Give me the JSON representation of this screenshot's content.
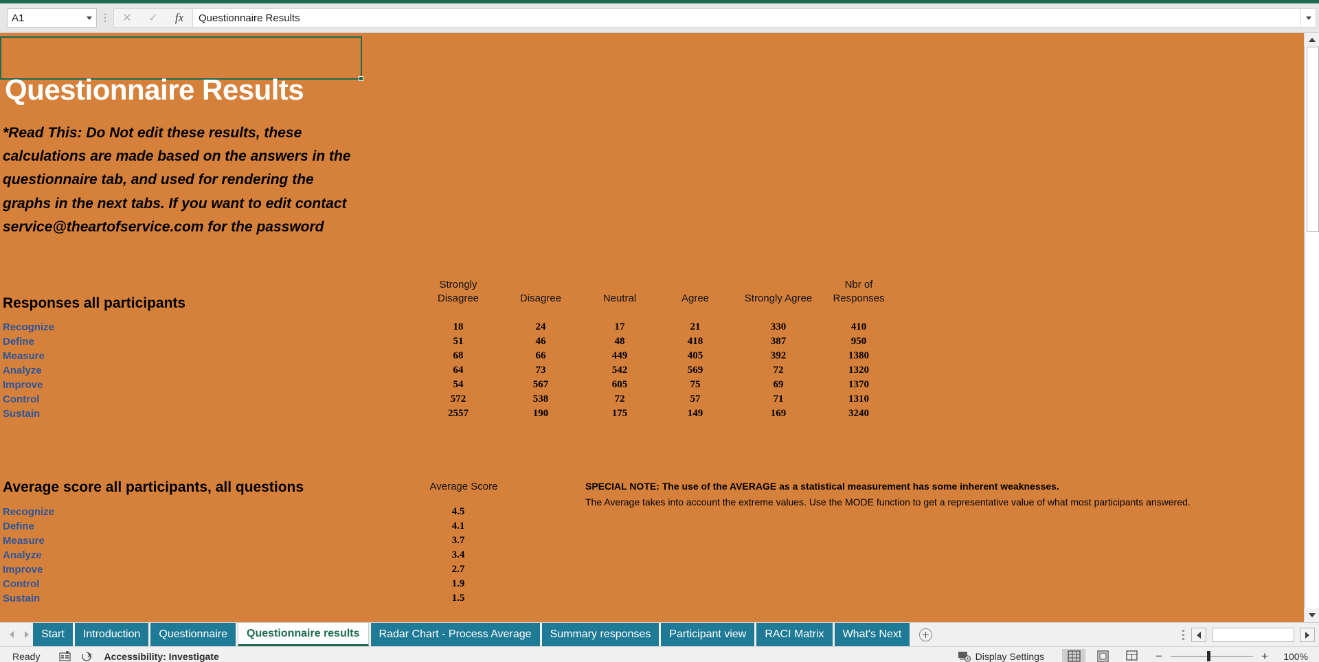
{
  "formula_bar": {
    "name_box": "A1",
    "cancel_icon": "close-icon",
    "confirm_icon": "check-icon",
    "function_icon": "fx-icon",
    "value": "Questionnaire Results"
  },
  "sheet": {
    "title": "Questionnaire Results",
    "warning": "*Read This: Do Not edit these results, these calculations are made based on the answers in the questionnaire tab, and used for rendering the graphs in the next tabs. If you want to edit contact service@theartofservice.com for the password",
    "background_color": "#D5813C",
    "title_color": "#FFFFFF",
    "label_color": "#2F5597",
    "section1": {
      "heading": "Responses all participants",
      "columns": [
        "Strongly\nDisagree",
        "Disagree",
        "Neutral",
        "Agree",
        "Strongly Agree",
        "Nbr of\nResponses"
      ],
      "rows": [
        {
          "label": "Recognize",
          "values": [
            "18",
            "24",
            "17",
            "21",
            "330",
            "410"
          ]
        },
        {
          "label": "Define",
          "values": [
            "51",
            "46",
            "48",
            "418",
            "387",
            "950"
          ]
        },
        {
          "label": "Measure",
          "values": [
            "68",
            "66",
            "449",
            "405",
            "392",
            "1380"
          ]
        },
        {
          "label": "Analyze",
          "values": [
            "64",
            "73",
            "542",
            "569",
            "72",
            "1320"
          ]
        },
        {
          "label": "Improve",
          "values": [
            "54",
            "567",
            "605",
            "75",
            "69",
            "1370"
          ]
        },
        {
          "label": "Control",
          "values": [
            "572",
            "538",
            "72",
            "57",
            "71",
            "1310"
          ]
        },
        {
          "label": "Sustain",
          "values": [
            "2557",
            "190",
            "175",
            "149",
            "169",
            "3240"
          ]
        }
      ]
    },
    "section2": {
      "heading": "Average score all participants, all questions",
      "column": "Average Score",
      "rows": [
        {
          "label": "Recognize",
          "value": "4.5"
        },
        {
          "label": "Define",
          "value": "4.1"
        },
        {
          "label": "Measure",
          "value": "3.7"
        },
        {
          "label": "Analyze",
          "value": "3.4"
        },
        {
          "label": "Improve",
          "value": "2.7"
        },
        {
          "label": "Control",
          "value": "1.9"
        },
        {
          "label": "Sustain",
          "value": "1.5"
        }
      ]
    },
    "special_note": {
      "bold": "SPECIAL NOTE: The use of the AVERAGE as a statistical measurement has some inherent weaknesses.",
      "regular": "The Average takes into account the extreme values. Use the MODE function to get a representative value of what most participants answered."
    }
  },
  "tabs": {
    "items": [
      {
        "label": "Start",
        "active": false
      },
      {
        "label": "Introduction",
        "active": false
      },
      {
        "label": "Questionnaire",
        "active": false
      },
      {
        "label": "Questionnaire results",
        "active": true
      },
      {
        "label": "Radar Chart - Process Average",
        "active": false
      },
      {
        "label": "Summary responses",
        "active": false
      },
      {
        "label": "Participant view",
        "active": false
      },
      {
        "label": "RACI Matrix",
        "active": false
      },
      {
        "label": "What's Next",
        "active": false
      }
    ],
    "add_sheet_icon": "plus-circle-icon",
    "active_color": "#1E6B52",
    "tab_color": "#1F7A96"
  },
  "status_bar": {
    "state": "Ready",
    "macro_icon": "record-macro-icon",
    "accessibility": "Accessibility: Investigate",
    "display_settings": "Display Settings",
    "view_normal_icon": "normal-view-icon",
    "view_layout_icon": "page-layout-icon",
    "view_break_icon": "page-break-view-icon",
    "zoom_out": "−",
    "zoom_in": "+",
    "zoom_level": "100%"
  }
}
